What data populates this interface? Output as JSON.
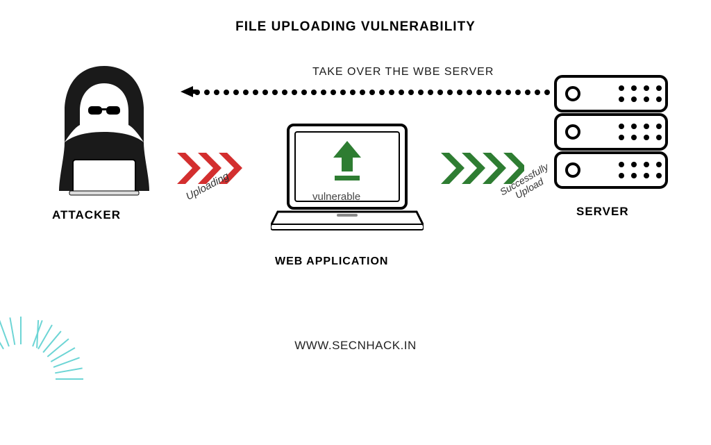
{
  "title": "FILE UPLOADING VULNERABILITY",
  "takeover_label": "TAKE OVER THE WBE SERVER",
  "attacker": {
    "label": "ATTACKER"
  },
  "webapp": {
    "label": "WEB APPLICATION",
    "vulnerable": "vulnerable"
  },
  "server": {
    "label": "SERVER"
  },
  "flows": {
    "uploading": "Uploading",
    "success_line1": "Successfully",
    "success_line2": "Upload"
  },
  "footer": "WWW.SECNHACK.IN"
}
